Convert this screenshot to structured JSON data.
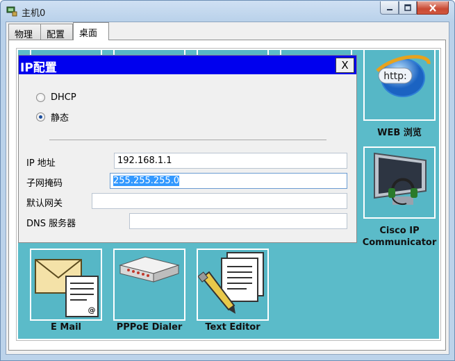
{
  "window": {
    "title": "主机0"
  },
  "tabs": [
    {
      "label": "物理"
    },
    {
      "label": "配置"
    },
    {
      "label": "桌面"
    }
  ],
  "desktop_apps": {
    "web": {
      "label": "WEB 浏览",
      "icon": "web-browser-icon"
    },
    "cisco_ip": {
      "label_line1": "Cisco IP",
      "label_line2": "Communicator",
      "icon": "ip-communicator-icon"
    },
    "email": {
      "label": "E Mail",
      "icon": "email-icon"
    },
    "pppoe": {
      "label": "PPPoE Dialer",
      "icon": "pppoe-dialer-icon"
    },
    "text_editor": {
      "label": "Text Editor",
      "icon": "text-editor-icon"
    }
  },
  "ip_dialog": {
    "title": "IP配置",
    "close_label": "X",
    "mode": {
      "options": [
        "DHCP",
        "静态"
      ],
      "selected": "静态"
    },
    "fields": {
      "ip_label": "IP 地址",
      "ip_value": "192.168.1.1",
      "mask_label": "子网掩码",
      "mask_value": "255.255.255.0",
      "gateway_label": "默认网关",
      "gateway_value": "",
      "dns_label": "DNS 服务器",
      "dns_value": ""
    }
  },
  "colors": {
    "desktop_bg": "#5bbbc9",
    "dialog_titlebar": "#0000ee",
    "selection": "#3399ff"
  }
}
